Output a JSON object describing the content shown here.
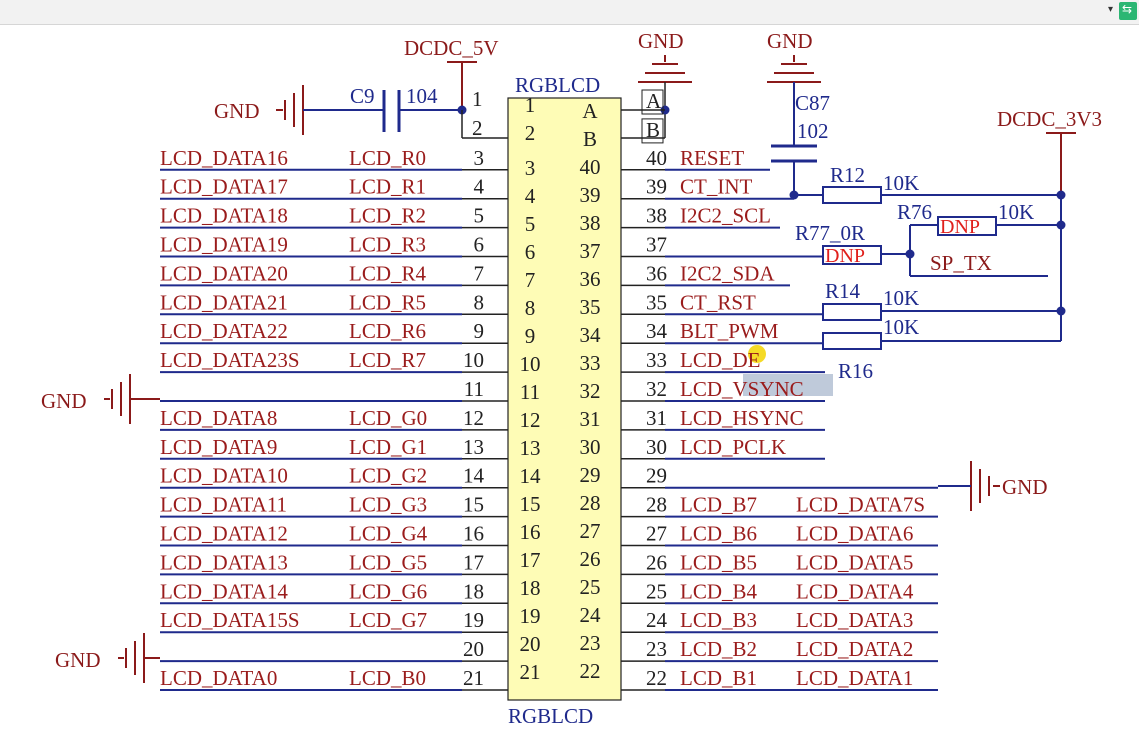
{
  "toolbar": {
    "dropdown": "▾"
  },
  "colors": {
    "wire": "#1f2a8c",
    "label": "#9a1c1c",
    "power": "#8b1a1a",
    "body_fill": "#fefcb6",
    "body_stroke": "#222222",
    "dnp": "#e0201c",
    "junction": "#1f2a8c",
    "highlight": "#f3d400",
    "selection": "#b8c4d6"
  },
  "net": {
    "dcdc5v": "DCDC_5V",
    "dcdc3v3": "DCDC_3V3",
    "gnd": "GND"
  },
  "component": {
    "name_top": "RGBLCD",
    "name_bottom": "RGBLCD",
    "pin_a": "A",
    "pin_b": "B"
  },
  "parts": {
    "c9": "C9",
    "c9_val": "104",
    "c87": "C87",
    "c87_val": "102",
    "r12": "R12",
    "r12_val": "10K",
    "r76": "R76",
    "r76_val": "10K",
    "r76_dnp": "DNP",
    "r77": "R77_0R",
    "r77_dnp": "DNP",
    "r14": "R14",
    "r14_val": "10K",
    "r16": "R16",
    "r16_val": "10K",
    "sp_tx": "SP_TX"
  },
  "left_rows": [
    {
      "outer": "",
      "num": "1",
      "inner": "1"
    },
    {
      "outer": "",
      "num": "2",
      "inner": "2"
    },
    {
      "net": "LCD_DATA16",
      "sig": "LCD_R0",
      "num": "3",
      "inner": "3"
    },
    {
      "net": "LCD_DATA17",
      "sig": "LCD_R1",
      "num": "4",
      "inner": "4"
    },
    {
      "net": "LCD_DATA18",
      "sig": "LCD_R2",
      "num": "5",
      "inner": "5"
    },
    {
      "net": "LCD_DATA19",
      "sig": "LCD_R3",
      "num": "6",
      "inner": "6"
    },
    {
      "net": "LCD_DATA20",
      "sig": "LCD_R4",
      "num": "7",
      "inner": "7"
    },
    {
      "net": "LCD_DATA21",
      "sig": "LCD_R5",
      "num": "8",
      "inner": "8"
    },
    {
      "net": "LCD_DATA22",
      "sig": "LCD_R6",
      "num": "9",
      "inner": "9"
    },
    {
      "net": "LCD_DATA23S",
      "sig": "LCD_R7",
      "num": "10",
      "inner": "10"
    },
    {
      "net": "",
      "sig": "",
      "num": "11",
      "inner": "11"
    },
    {
      "net": "LCD_DATA8",
      "sig": "LCD_G0",
      "num": "12",
      "inner": "12"
    },
    {
      "net": "LCD_DATA9",
      "sig": "LCD_G1",
      "num": "13",
      "inner": "13"
    },
    {
      "net": "LCD_DATA10",
      "sig": "LCD_G2",
      "num": "14",
      "inner": "14"
    },
    {
      "net": "LCD_DATA11",
      "sig": "LCD_G3",
      "num": "15",
      "inner": "15"
    },
    {
      "net": "LCD_DATA12",
      "sig": "LCD_G4",
      "num": "16",
      "inner": "16"
    },
    {
      "net": "LCD_DATA13",
      "sig": "LCD_G5",
      "num": "17",
      "inner": "17"
    },
    {
      "net": "LCD_DATA14",
      "sig": "LCD_G6",
      "num": "18",
      "inner": "18"
    },
    {
      "net": "LCD_DATA15S",
      "sig": "LCD_G7",
      "num": "19",
      "inner": "19"
    },
    {
      "net": "",
      "sig": "",
      "num": "20",
      "inner": "20"
    },
    {
      "net": "LCD_DATA0",
      "sig": "LCD_B0",
      "num": "21",
      "inner": "21"
    }
  ],
  "right_rows": [
    {
      "inner": "A",
      "num": "A",
      "sig": ""
    },
    {
      "inner": "B",
      "num": "B",
      "sig": ""
    },
    {
      "inner": "40",
      "num": "40",
      "sig": "RESET"
    },
    {
      "inner": "39",
      "num": "39",
      "sig": "CT_INT"
    },
    {
      "inner": "38",
      "num": "38",
      "sig": "I2C2_SCL"
    },
    {
      "inner": "37",
      "num": "37",
      "sig": ""
    },
    {
      "inner": "36",
      "num": "36",
      "sig": "I2C2_SDA"
    },
    {
      "inner": "35",
      "num": "35",
      "sig": "CT_RST"
    },
    {
      "inner": "34",
      "num": "34",
      "sig": "BLT_PWM"
    },
    {
      "inner": "33",
      "num": "33",
      "sig": "LCD_DE"
    },
    {
      "inner": "32",
      "num": "32",
      "sig": "LCD_VSYNC"
    },
    {
      "inner": "31",
      "num": "31",
      "sig": "LCD_HSYNC"
    },
    {
      "inner": "30",
      "num": "30",
      "sig": "LCD_PCLK"
    },
    {
      "inner": "29",
      "num": "29",
      "sig": ""
    },
    {
      "inner": "28",
      "num": "28",
      "sig": "LCD_B7",
      "net": "LCD_DATA7S"
    },
    {
      "inner": "27",
      "num": "27",
      "sig": "LCD_B6",
      "net": "LCD_DATA6"
    },
    {
      "inner": "26",
      "num": "26",
      "sig": "LCD_B5",
      "net": "LCD_DATA5"
    },
    {
      "inner": "25",
      "num": "25",
      "sig": "LCD_B4",
      "net": "LCD_DATA4"
    },
    {
      "inner": "24",
      "num": "24",
      "sig": "LCD_B3",
      "net": "LCD_DATA3"
    },
    {
      "inner": "23",
      "num": "23",
      "sig": "LCD_B2",
      "net": "LCD_DATA2"
    },
    {
      "inner": "22",
      "num": "22",
      "sig": "LCD_B1",
      "net": "LCD_DATA1"
    }
  ]
}
